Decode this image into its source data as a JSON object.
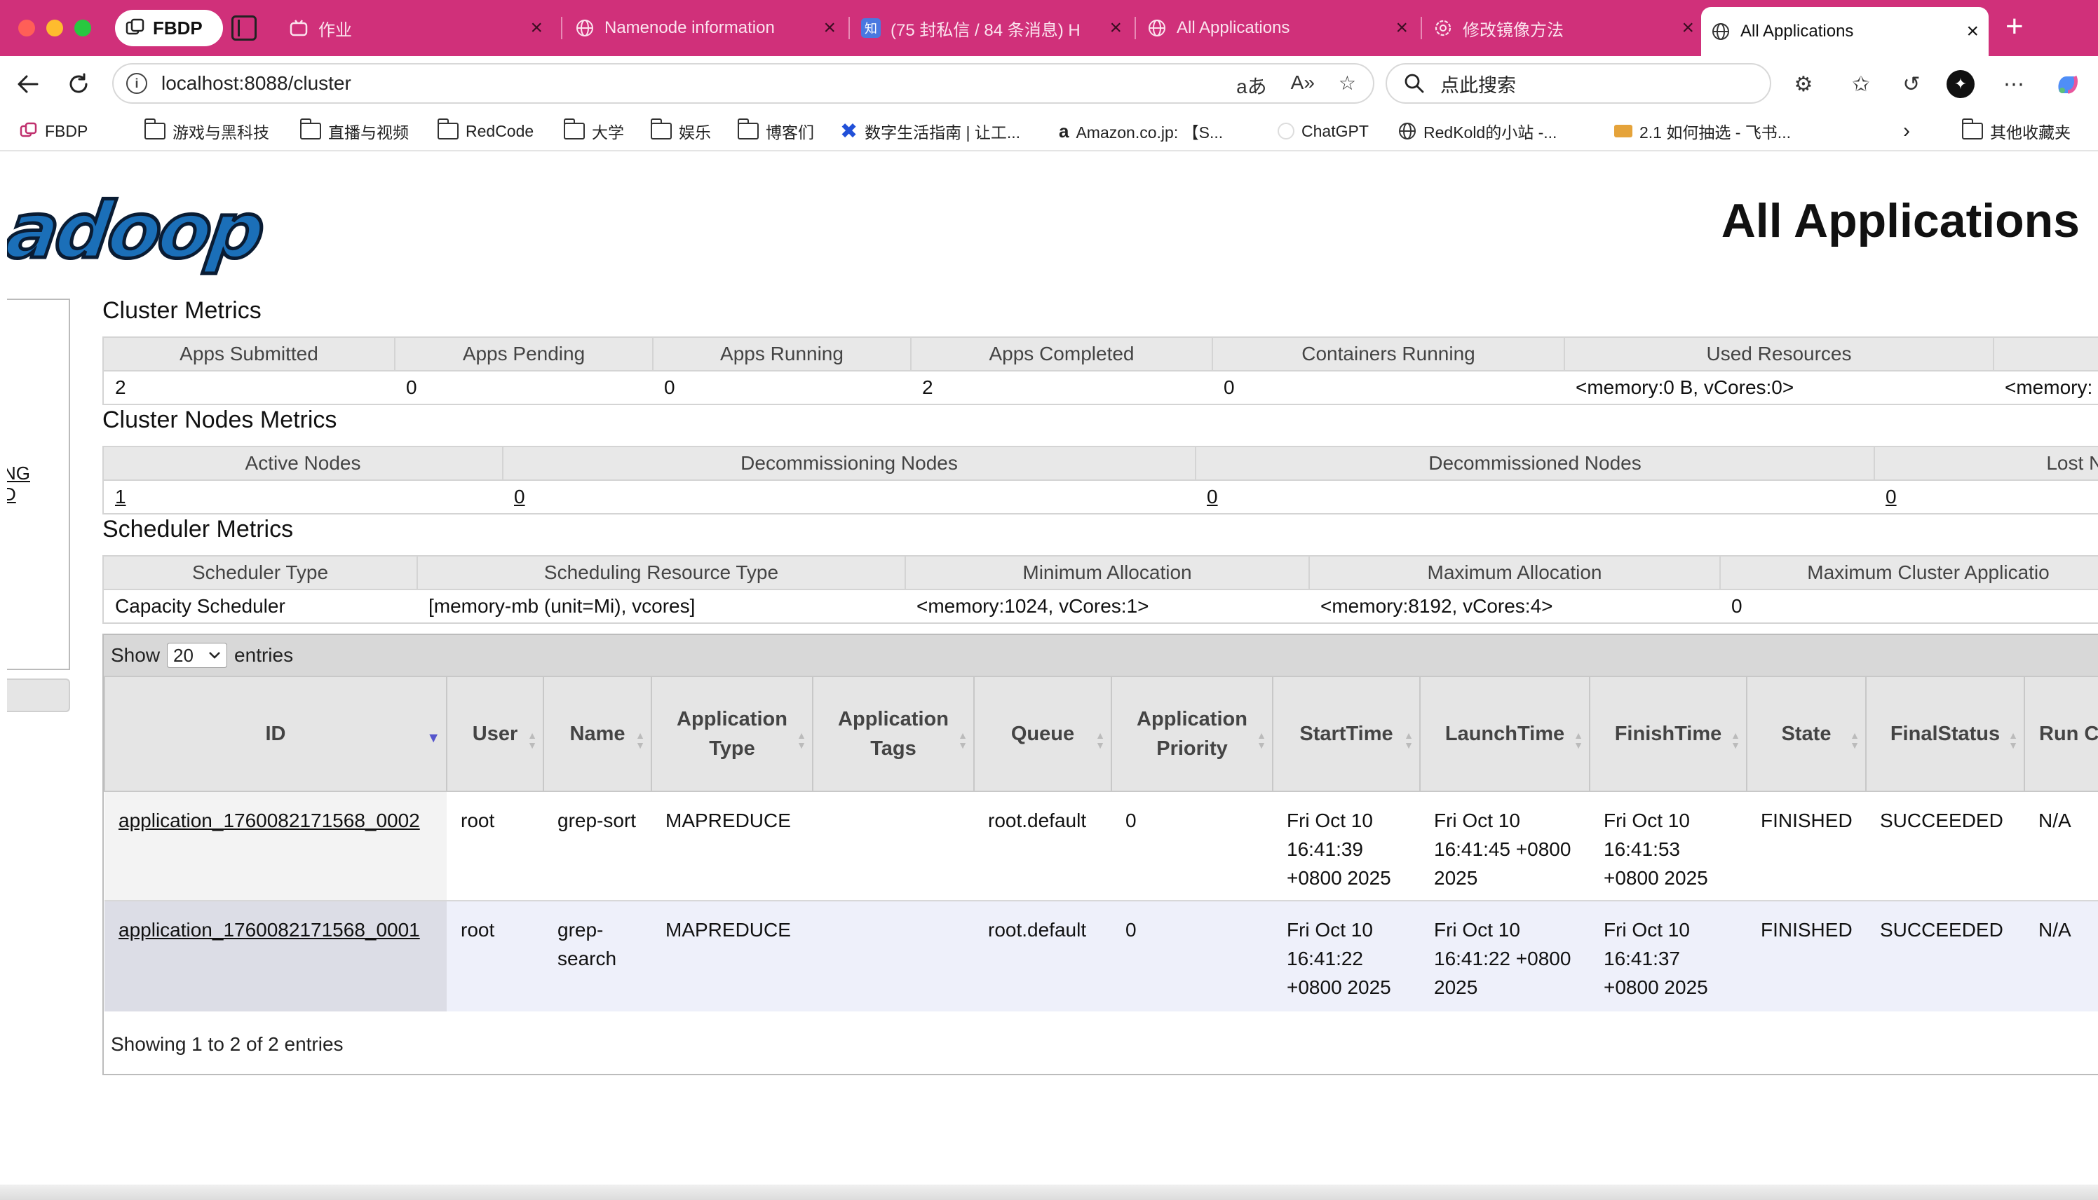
{
  "browser": {
    "profile_label": "FBDP",
    "tabs": [
      {
        "title": "作业",
        "icon": "bilibili-icon"
      },
      {
        "title": "Namenode information",
        "icon": "globe-icon"
      },
      {
        "title": "(75 封私信 / 84 条消息) H",
        "icon": "zhihu-icon"
      },
      {
        "title": "All Applications",
        "icon": "globe-icon"
      },
      {
        "title": "修改镜像方法",
        "icon": "chatgpt-icon"
      },
      {
        "title": "All Applications",
        "icon": "globe-icon",
        "active": true
      }
    ],
    "url": "localhost:8088/cluster",
    "search_placeholder": "点此搜索",
    "bookmarks": [
      "FBDP",
      "游戏与黑科技",
      "直播与视频",
      "RedCode",
      "大学",
      "娱乐",
      "博客们",
      "数字生活指南 | 让工...",
      "Amazon.co.jp: 【S...",
      "ChatGPT",
      "RedKold的小站 -...",
      "2.1 如何抽选 - 飞书...",
      "其他收藏夹"
    ]
  },
  "page": {
    "logo_text": "adoop",
    "title": "All Applications",
    "sidebar_links": [
      "NG",
      "D"
    ]
  },
  "cluster_metrics": {
    "title": "Cluster Metrics",
    "headers": [
      "Apps Submitted",
      "Apps Pending",
      "Apps Running",
      "Apps Completed",
      "Containers Running",
      "Used Resources",
      ""
    ],
    "values": [
      "2",
      "0",
      "0",
      "2",
      "0",
      "<memory:0 B, vCores:0>",
      "<memory:"
    ]
  },
  "cluster_nodes_metrics": {
    "title": "Cluster Nodes Metrics",
    "headers": [
      "Active Nodes",
      "Decommissioning Nodes",
      "Decommissioned Nodes",
      "Lost Node"
    ],
    "values": [
      "1",
      "0",
      "0",
      "0"
    ]
  },
  "scheduler_metrics": {
    "title": "Scheduler Metrics",
    "headers": [
      "Scheduler Type",
      "Scheduling Resource Type",
      "Minimum Allocation",
      "Maximum Allocation",
      "Maximum Cluster Applicatio"
    ],
    "values": [
      "Capacity Scheduler",
      "[memory-mb (unit=Mi), vcores]",
      "<memory:1024, vCores:1>",
      "<memory:8192, vCores:4>",
      "0"
    ]
  },
  "applications": {
    "show_label": "Show",
    "entries_select": "20",
    "entries_label": "entries",
    "headers": [
      "ID",
      "User",
      "Name",
      "Application Type",
      "Application Tags",
      "Queue",
      "Application Priority",
      "StartTime",
      "LaunchTime",
      "FinishTime",
      "State",
      "FinalStatus",
      "Run Cont"
    ],
    "rows": [
      {
        "id": "application_1760082171568_0002",
        "user": "root",
        "name": "grep-sort",
        "type": "MAPREDUCE",
        "tags": "",
        "queue": "root.default",
        "priority": "0",
        "start": "Fri Oct 10 16:41:39 +0800 2025",
        "launch": "Fri Oct 10 16:41:45 +0800 2025",
        "finish": "Fri Oct 10 16:41:53 +0800 2025",
        "state": "FINISHED",
        "final_status": "SUCCEEDED",
        "running": "N/A"
      },
      {
        "id": "application_1760082171568_0001",
        "user": "root",
        "name": "grep-search",
        "type": "MAPREDUCE",
        "tags": "",
        "queue": "root.default",
        "priority": "0",
        "start": "Fri Oct 10 16:41:22 +0800 2025",
        "launch": "Fri Oct 10 16:41:22 +0800 2025",
        "finish": "Fri Oct 10 16:41:37 +0800 2025",
        "state": "FINISHED",
        "final_status": "SUCCEEDED",
        "running": "N/A"
      }
    ],
    "showing_text": "Showing 1 to 2 of 2 entries"
  }
}
